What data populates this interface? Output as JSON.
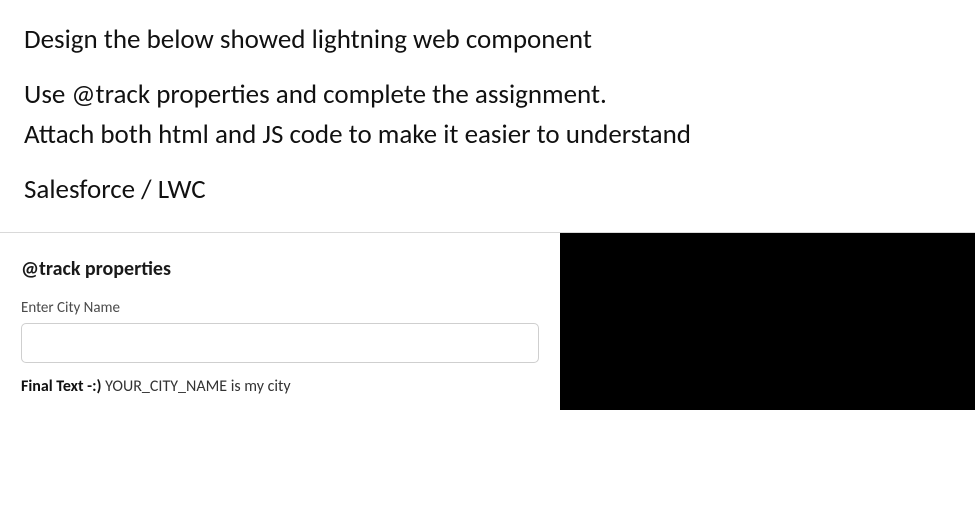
{
  "instructions": {
    "line1": "Design the below showed lightning web component",
    "line2": "Use @track properties and complete the assignment.",
    "line3": "Attach both html and JS code to make it easier to understand",
    "line4": "Salesforce / LWC"
  },
  "component": {
    "title": "@track properties",
    "input": {
      "label": "Enter City Name",
      "value": "",
      "placeholder": ""
    },
    "result": {
      "label": "Final Text -:) ",
      "value": "YOUR_CITY_NAME is my city"
    }
  }
}
